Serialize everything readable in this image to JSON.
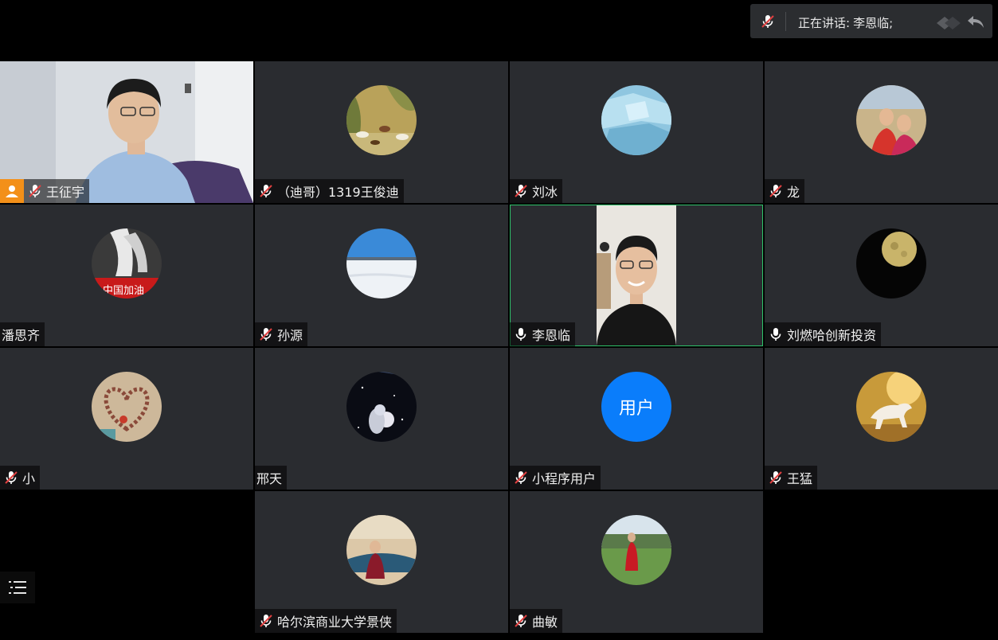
{
  "speaking": {
    "label": "正在讲话:",
    "names": "李恩临;"
  },
  "participants": [
    {
      "name": "王征宇",
      "mic": "muted",
      "host": true,
      "video": true
    },
    {
      "name": "（迪哥）1319王俊迪",
      "mic": "muted",
      "avatar": "horses-painting"
    },
    {
      "name": "刘冰",
      "mic": "muted",
      "avatar": "ice"
    },
    {
      "name": "龙",
      "mic": "muted",
      "avatar": "couple-photo"
    },
    {
      "name": "潘思齐",
      "mic": "none",
      "avatar": "china-hands"
    },
    {
      "name": "孙源",
      "mic": "muted",
      "avatar": "snow-field"
    },
    {
      "name": "李恩临",
      "mic": "on",
      "video": true,
      "active": true
    },
    {
      "name": "刘燃哈创新投资",
      "mic": "on",
      "avatar": "moon"
    },
    {
      "name": "小",
      "mic": "muted",
      "avatar": "heart-stones"
    },
    {
      "name": "邢天",
      "mic": "none",
      "avatar": "astronaut"
    },
    {
      "name": "小程序用户",
      "mic": "muted",
      "avatar_text": "用户"
    },
    {
      "name": "王猛",
      "mic": "muted",
      "avatar": "white-horse"
    },
    {
      "name": "哈尔滨商业大学景侠",
      "mic": "muted",
      "avatar": "woman-sofa"
    },
    {
      "name": "曲敏",
      "mic": "muted",
      "avatar": "woman-red-dress"
    }
  ],
  "colors": {
    "tile_bg": "#2a2c30",
    "active_border": "#2ec26a",
    "host_badge": "#f39019",
    "user_avatar": "#0a7dfb",
    "muted_red": "#e04040"
  }
}
